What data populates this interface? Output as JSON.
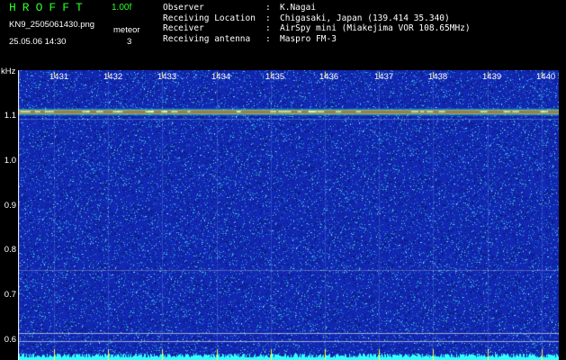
{
  "header": {
    "app_title": "HROFFT",
    "version": "1.00f",
    "filename": "KN9_2505061430.png",
    "datetime": "25.05.06 14:30",
    "mode_label": "meteor",
    "mode_value": "3"
  },
  "station": [
    {
      "label": "Observer",
      "value": "K.Nagai"
    },
    {
      "label": "Receiving Location",
      "value": "Chigasaki, Japan (139.414 35.340)"
    },
    {
      "label": "Receiver",
      "value": "AirSpy mini (Miakejima VOR 108.65MHz)"
    },
    {
      "label": "Receiving antenna",
      "value": "Maspro FM-3"
    }
  ],
  "axis": {
    "y_unit": "kHz",
    "y_ticks": [
      "1.1",
      "1.0",
      "0.9",
      "0.8",
      "0.7",
      "0.6"
    ],
    "x_ticks": [
      "1431",
      "1432",
      "1433",
      "1434",
      "1435",
      "1436",
      "1437",
      "1438",
      "1439",
      "1440"
    ]
  },
  "colors": {
    "background": "#000000",
    "title_green": "#2aff2a",
    "spectrum_bg": "#1a2fa8",
    "carrier_line": "#ff3a2a",
    "baseline_cyan": "#33ffff"
  }
}
